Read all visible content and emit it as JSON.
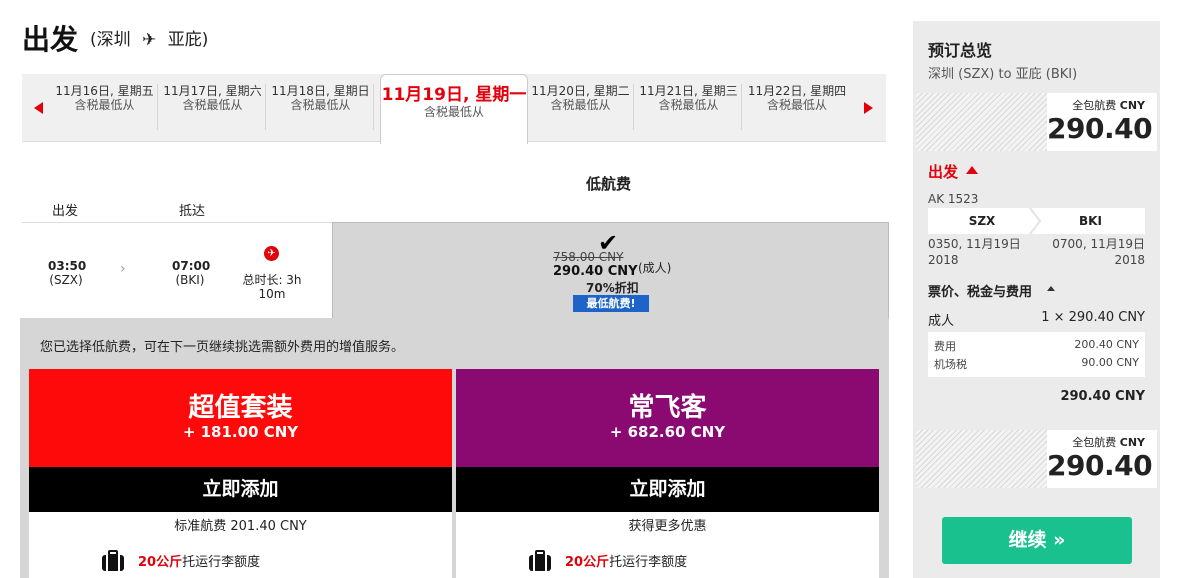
{
  "header": {
    "title": "出发",
    "route_open": "(深圳",
    "route_plane": "✈",
    "route_close": "亚庇)"
  },
  "date_tabs": [
    {
      "date": "11月16日, 星期五",
      "sub": "含税最低从"
    },
    {
      "date": "11月17日, 星期六",
      "sub": "含税最低从"
    },
    {
      "date": "11月18日, 星期日",
      "sub": "含税最低从"
    },
    {
      "date": "11月19日, 星期一",
      "sub": "含税最低从",
      "active": true
    },
    {
      "date": "11月20日, 星期二",
      "sub": "含税最低从"
    },
    {
      "date": "11月21日, 星期三",
      "sub": "含税最低从"
    },
    {
      "date": "11月22日, 星期四",
      "sub": "含税最低从"
    }
  ],
  "fare_table": {
    "fare_column_title": "低航费",
    "col_departure": "出发",
    "col_arrival": "抵达"
  },
  "flight": {
    "dep_time": "03:50",
    "dep_code": "(SZX)",
    "arr_time": "07:00",
    "arr_code": "(BKI)",
    "arrow": "›",
    "duration_line1": "总时长: 3h",
    "duration_line2": "10m",
    "fare": {
      "original": "758.00 CNY",
      "price": "290.40 CNY",
      "pax": "(成人)",
      "discount": "70%折扣",
      "badge": "最低航费!"
    }
  },
  "notice": "您已选择低航费，可在下一页继续挑选需额外费用的增值服务。",
  "bundles": [
    {
      "name": "超值套装",
      "price": "+ 181.00 CNY",
      "button": "立即添加",
      "subtitle": "标准航费 201.40 CNY",
      "feature_highlight": "20公斤",
      "feature_text": "托运行李额度",
      "color": "#ff0a0a"
    },
    {
      "name": "常飞客",
      "price": "+ 682.60 CNY",
      "button": "立即添加",
      "subtitle": "获得更多优惠",
      "feature_highlight": "20公斤",
      "feature_text": "托运行李额度",
      "color": "#8b0a72"
    }
  ],
  "sidebar": {
    "title": "预订总览",
    "route": "深圳 (SZX) to 亚庇 (BKI)",
    "total_label": "全包航费",
    "total_currency": "CNY",
    "total_amount": "290.40",
    "departure_label": "出发",
    "flight_no": "AK 1523",
    "seg_from": "SZX",
    "seg_to": "BKI",
    "dep_datetime": "0350, 11月19日",
    "dep_year": "2018",
    "arr_datetime": "0700, 11月19日",
    "arr_year": "2018",
    "fees_heading": "票价、税金与费用",
    "adult_label": "成人",
    "adult_value": "1 × 290.40 CNY",
    "fee_label": "费用",
    "fee_value": "200.40 CNY",
    "tax_label": "机场税",
    "tax_value": "90.00 CNY",
    "subtotal": "290.40 CNY",
    "continue": "继续 »"
  },
  "colors": {
    "accent_red": "#e3000b",
    "continue_green": "#19c18f",
    "badge_blue": "#1e64c8"
  }
}
